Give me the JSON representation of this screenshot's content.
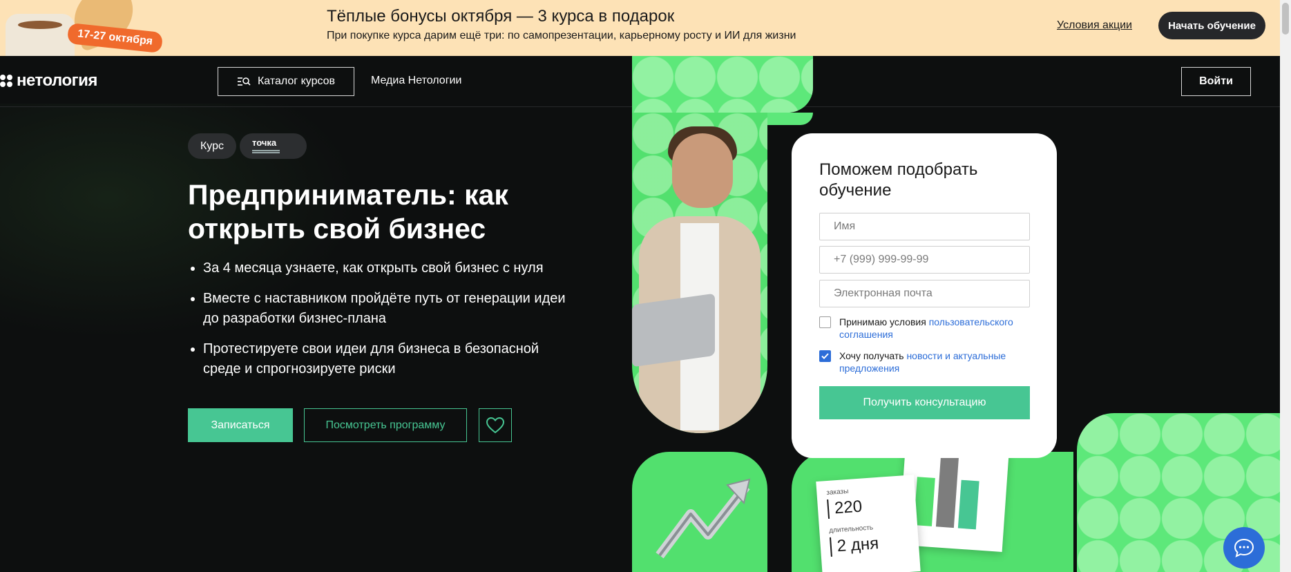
{
  "promo": {
    "date_badge": "17-27 октября",
    "title": "Тёплые бонусы октября — 3 курса в подарок",
    "subtitle": "При покупке курса дарим ещё три: по самопрезентации, карьерному росту и ИИ для жизни",
    "terms_link": "Условия акции",
    "cta": "Начать обучение"
  },
  "header": {
    "logo": "нетология",
    "catalog": "Каталог курсов",
    "media": "Медиа Нетологии",
    "login": "Войти"
  },
  "hero": {
    "tag_course": "Курс",
    "partner": "точка",
    "title": "Предприниматель: как открыть свой бизнес",
    "bullets": [
      "За 4 месяца узнаете, как открыть свой бизнес с нуля",
      "Вместе с наставником пройдёте путь от генерации идеи до разработки бизнес-плана",
      "Протестируете свои идеи для бизнеса в безопасной среде и спрогнозируете риски"
    ],
    "enroll": "Записаться",
    "program": "Посмотреть программу"
  },
  "form": {
    "title": "Поможем подобрать обучение",
    "name_placeholder": "Имя",
    "phone_placeholder": "+7 (999) 999-99-99",
    "email_placeholder": "Электронная почта",
    "agree_text": "Принимаю условия ",
    "agree_link": "пользовательского соглашения",
    "agree_checked": false,
    "news_text": "Хочу получать ",
    "news_link": "новости и актуальные предложения",
    "news_checked": true,
    "submit": "Получить консультацию"
  },
  "stats": {
    "orders_label": "заказы",
    "orders_value": "220",
    "duration_label": "длительность",
    "duration_value": "2 дня"
  },
  "colors": {
    "accent": "#47c693",
    "green": "#52e06e",
    "promo_bg": "#fde2b6",
    "link": "#2c6dd8",
    "page_bg": "#0d0f0f"
  },
  "icons": {
    "catalog": "catalog-search-icon",
    "favorite": "heart-icon",
    "chat": "chat-icon",
    "check": "check-icon"
  }
}
